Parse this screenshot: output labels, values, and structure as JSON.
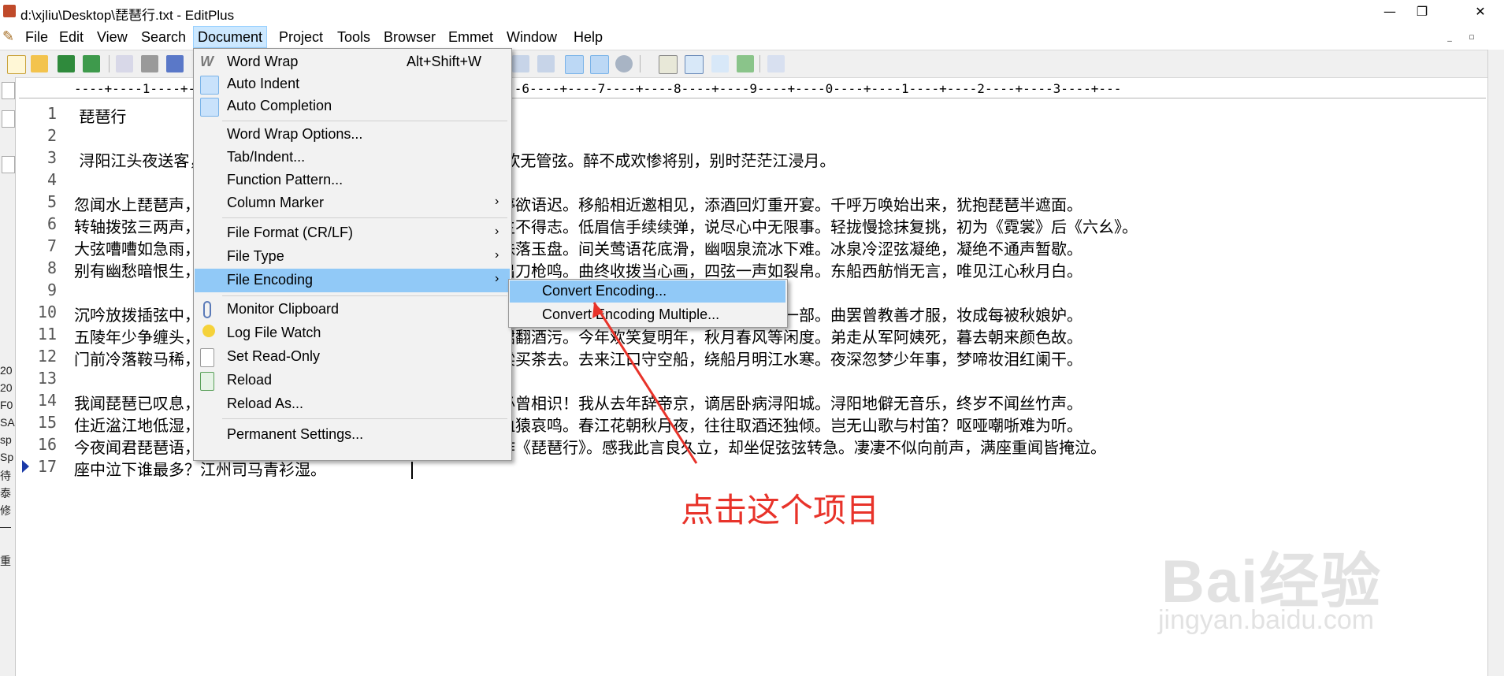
{
  "window": {
    "title": "d:\\xjliu\\Desktop\\琵琶行.txt - EditPlus",
    "minimize": "—",
    "maximize": "❐",
    "close": "✕"
  },
  "menubar": {
    "items": [
      {
        "label": "File"
      },
      {
        "label": "Edit"
      },
      {
        "label": "View"
      },
      {
        "label": "Search"
      },
      {
        "label": "Document"
      },
      {
        "label": "Project"
      },
      {
        "label": "Tools"
      },
      {
        "label": "Browser"
      },
      {
        "label": "Emmet"
      },
      {
        "label": "Window"
      },
      {
        "label": "Help"
      }
    ],
    "active": "Document",
    "mdi_minimize": "_",
    "mdi_restore": "▫"
  },
  "ruler": "----+----1----+----2----+----3----+----4----+----5----+----6----+----7----+----8----+----9----+----0----+----1----+----2----+----3----+---",
  "editor": {
    "lines": [
      {
        "num": "1",
        "text": " 琵琶行"
      },
      {
        "num": "2",
        "text": ""
      },
      {
        "num": "3",
        "text": " 浔阳江头夜送客，枫叶荻花秋瑟瑟。主人下马客在船，举酒欲饮无管弦。醉不成欢惨将别，别时茫茫江浸月。"
      },
      {
        "num": "4",
        "text": ""
      },
      {
        "num": "5",
        "text": "忽闻水上琵琶声，主人忘归客不发。寻声暗问弹者谁，琵琶声停欲语迟。移船相近邀相见，添酒回灯重开宴。千呼万唤始出来，犹抱琵琶半遮面。"
      },
      {
        "num": "6",
        "text": "转轴拨弦三两声，未成曲调先有情。弦弦掩抑声声思，似诉平生不得志。低眉信手续续弹，说尽心中无限事。轻拢慢捻抹复挑，初为《霓裳》后《六幺》。"
      },
      {
        "num": "7",
        "text": "大弦嘈嘈如急雨，小弦切切如私语。嘈嘈切切错杂弹，大珠小珠落玉盘。间关莺语花底滑，幽咽泉流冰下难。冰泉冷涩弦凝绝，凝绝不通声暂歇。"
      },
      {
        "num": "8",
        "text": "别有幽愁暗恨生，此时无声胜有声。银瓶乍破水浆迸，铁骑突出刀枪鸣。曲终收拨当心画，四弦一声如裂帛。东船西舫悄无言，唯见江心秋月白。"
      },
      {
        "num": "9",
        "text": ""
      },
      {
        "num": "10",
        "text": "沉吟放拨插弦中，整顿衣裳起敛容。自言本是京城女，家在虾蟆陵下住。十三学得琵琶成，名属教坊第一部。曲罢曾教善才服，妆成每被秋娘妒。"
      },
      {
        "num": "11",
        "text": "五陵年少争缠头，一曲红绡不知数。钿头银篦击节碎，血色罗裙翻酒污。今年欢笑复明年，秋月春风等闲度。弟走从军阿姨死，暮去朝来颜色故。"
      },
      {
        "num": "12",
        "text": "门前冷落鞍马稀，老大嫁作商人妇。商人重利轻别离，前月浮梁买茶去。去来江口守空船，绕船月明江水寒。夜深忽梦少年事，梦啼妆泪红阑干。"
      },
      {
        "num": "13",
        "text": ""
      },
      {
        "num": "14",
        "text": "我闻琵琶已叹息，又闻此语重唧唧。同是天涯沦落人，相逢何必曾相识！我从去年辞帝京，谪居卧病浔阳城。浔阳地僻无音乐，终岁不闻丝竹声。"
      },
      {
        "num": "15",
        "text": "住近湓江地低湿，黄芦苦竹绕宅生。其间旦暮闻何物？杜鹃啼血猿哀鸣。春江花朝秋月夜，往往取酒还独倾。岂无山歌与村笛？呕哑嘲哳难为听。"
      },
      {
        "num": "16",
        "text": "今夜闻君琵琶语，如听仙乐耳暂明。莫辞更坐弹一曲，为君翻作《琵琶行》。感我此言良久立，却坐促弦弦转急。凄凄不似向前声，满座重闻皆掩泣。"
      },
      {
        "num": "17",
        "text": "座中泣下谁最多？江州司马青衫湿。"
      }
    ]
  },
  "left_strip": {
    "texts": [
      "20",
      "20",
      "F0",
      "SA",
      "sp",
      "Sp",
      "待",
      "泰",
      "修",
      "—",
      "重"
    ]
  },
  "document_menu": {
    "items": [
      {
        "label": "Word Wrap",
        "shortcut": "Alt+Shift+W",
        "icon": "word-wrap-icon"
      },
      {
        "label": "Auto Indent",
        "icon": "auto-indent-icon"
      },
      {
        "label": "Auto Completion",
        "icon": "auto-completion-icon"
      },
      {
        "label": "Word Wrap Options..."
      },
      {
        "label": "Tab/Indent..."
      },
      {
        "label": "Function Pattern..."
      },
      {
        "label": "Column Marker",
        "arrow": "›"
      },
      {
        "label": "File Format (CR/LF)",
        "arrow": "›"
      },
      {
        "label": "File Type",
        "arrow": "›"
      },
      {
        "label": "File Encoding",
        "arrow": "›"
      },
      {
        "label": "Monitor Clipboard",
        "icon": "clipboard-icon"
      },
      {
        "label": "Log File Watch",
        "icon": "lightbulb-icon"
      },
      {
        "label": "Set Read-Only",
        "icon": "read-only-icon"
      },
      {
        "label": "Reload",
        "icon": "reload-icon"
      },
      {
        "label": "Reload As..."
      },
      {
        "label": "Permanent Settings..."
      }
    ],
    "highlighted": "File Encoding"
  },
  "encoding_submenu": {
    "items": [
      {
        "label": "Convert Encoding..."
      },
      {
        "label": "Convert Encoding Multiple..."
      }
    ],
    "highlighted": "Convert Encoding..."
  },
  "annotation": {
    "text": "点击这个项目",
    "color": "#e8332a"
  },
  "watermark": {
    "brand": "Bai经验",
    "url": "jingyan.baidu.com"
  },
  "colors": {
    "menu_highlight": "#91c9f7",
    "active_menu": "#cce8ff",
    "caret_marker": "#1a3aa8"
  }
}
